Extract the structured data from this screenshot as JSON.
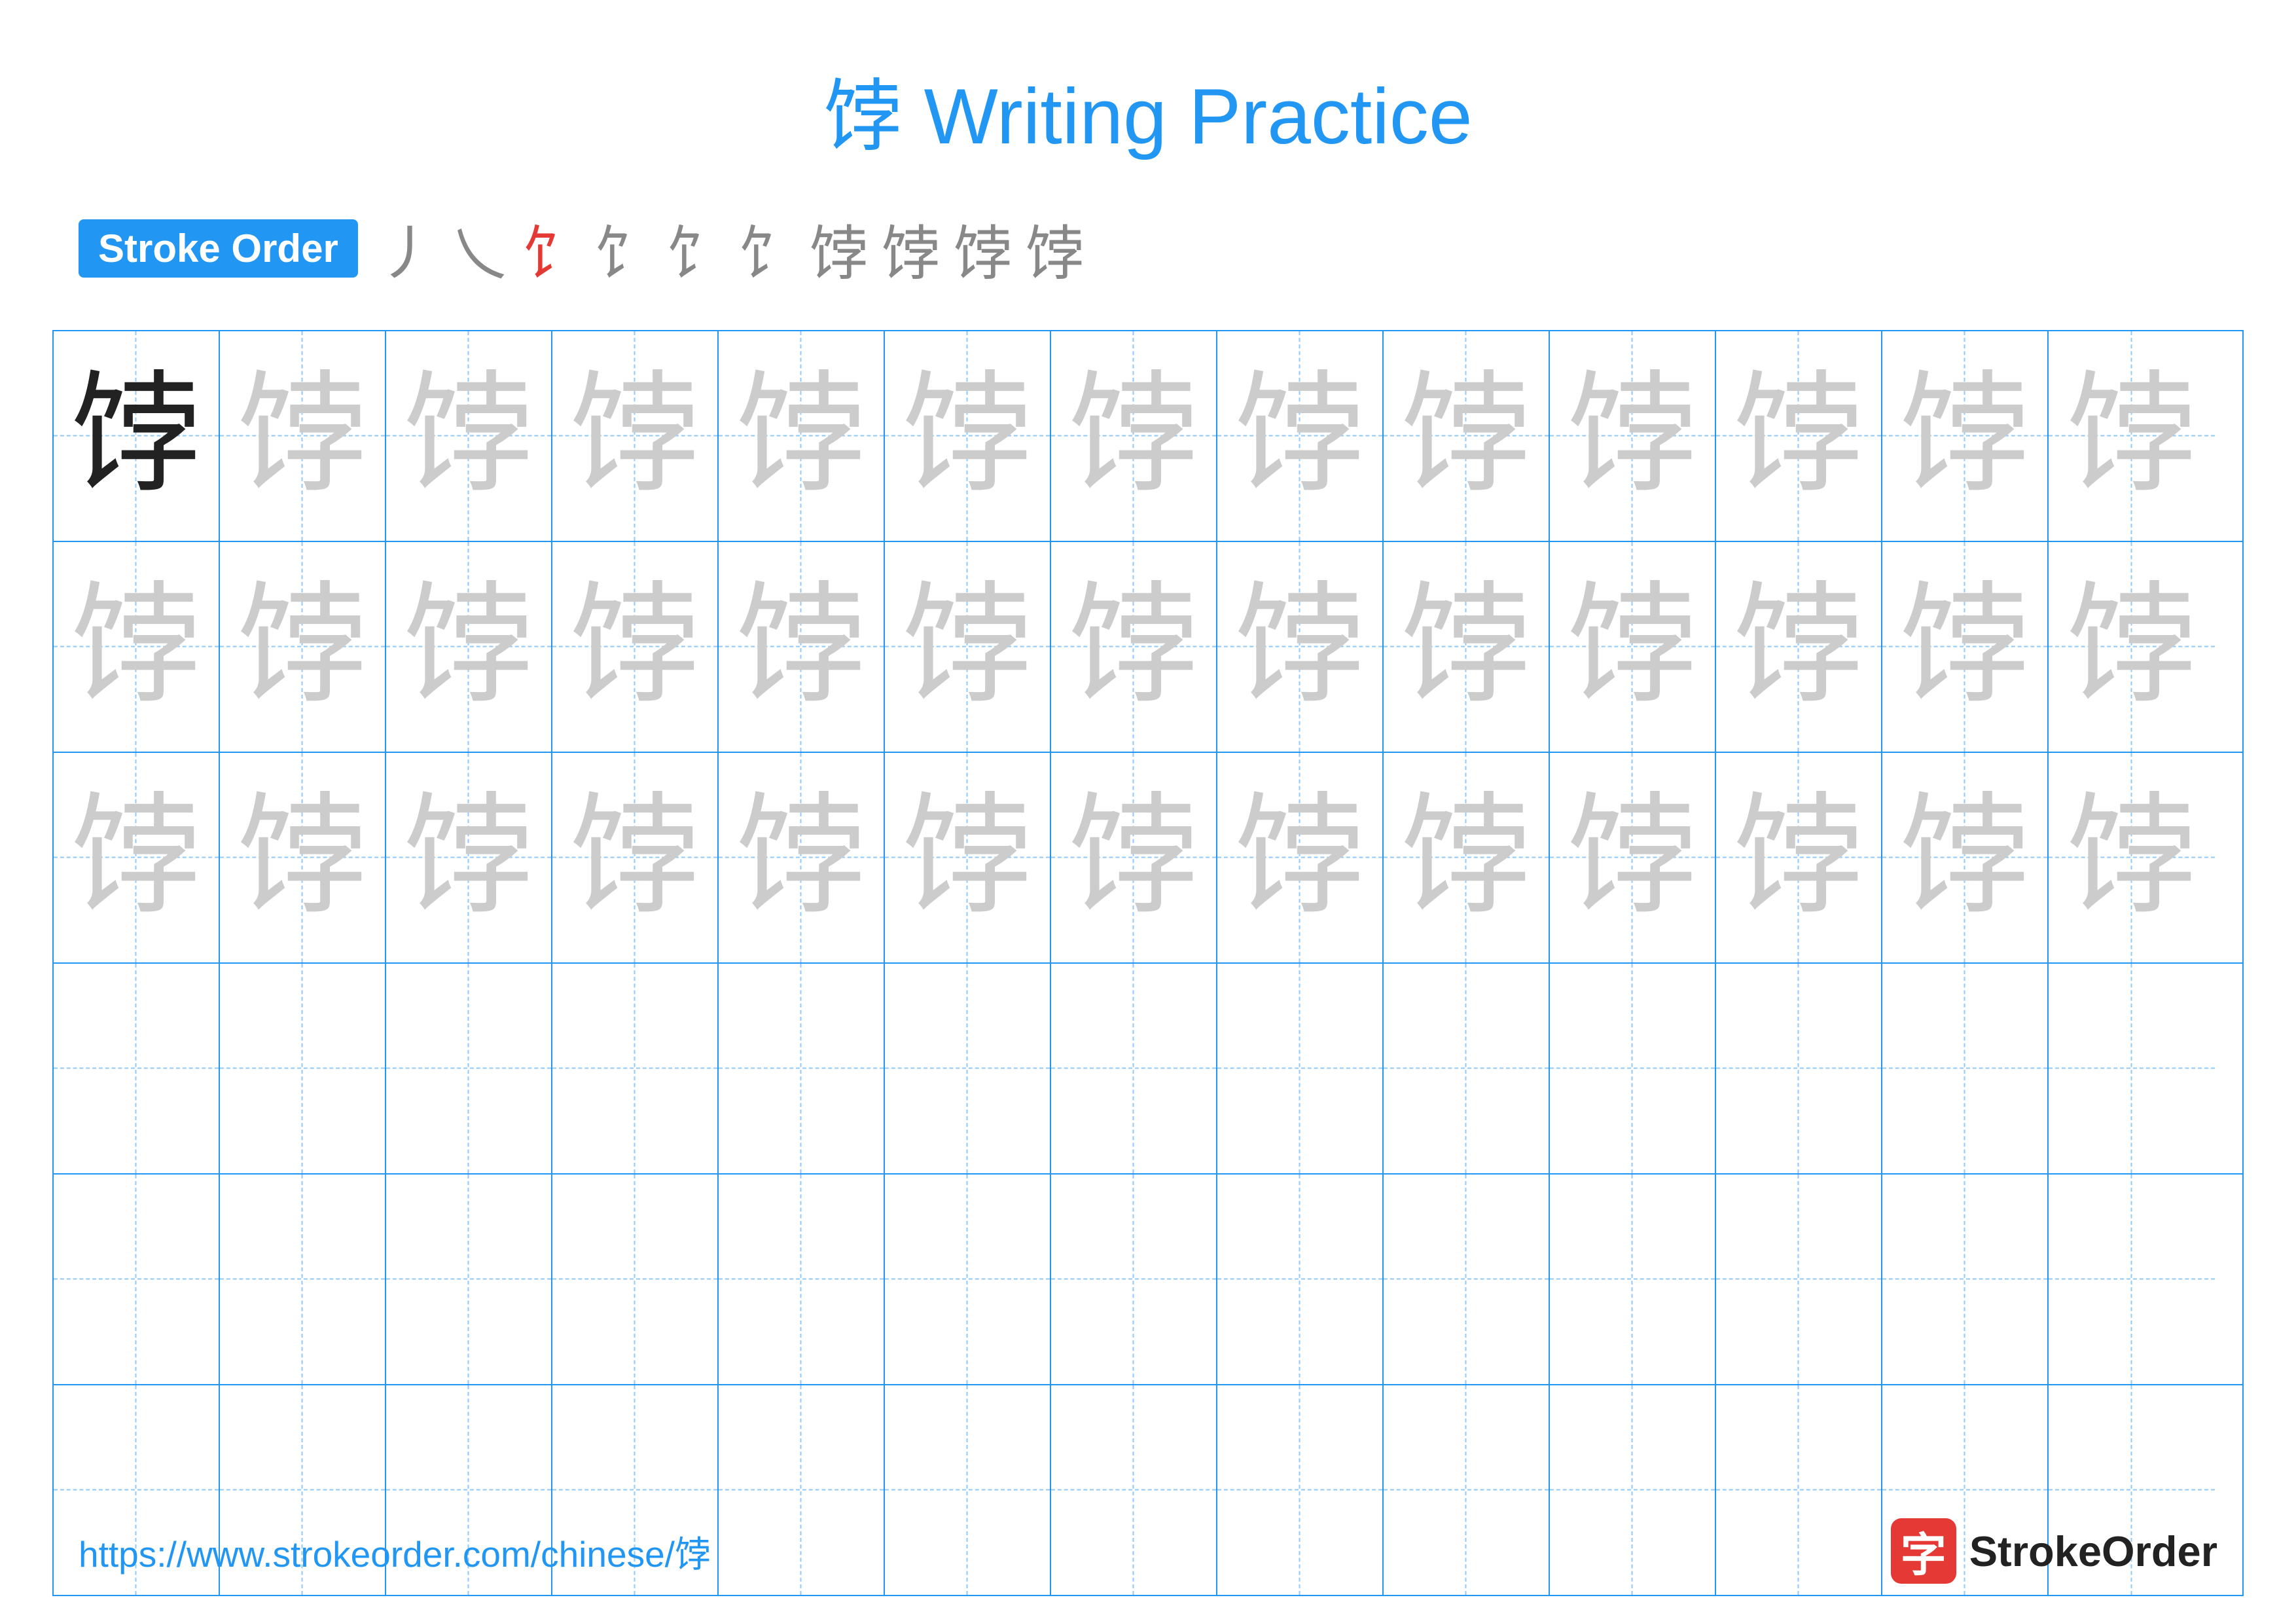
{
  "title": "饽 Writing Practice",
  "strokeOrder": {
    "badge": "Stroke Order",
    "strokes": [
      "丿",
      "乀",
      "饣",
      "饣⁻",
      "饣⁺",
      "饣⁺⁺",
      "饽⁻",
      "饽",
      "饽",
      "饽"
    ]
  },
  "character": "饽",
  "grid": {
    "rows": 6,
    "cols": 13
  },
  "footer": {
    "url": "https://www.strokeorder.com/chinese/饽",
    "logoText": "StrokeOrder",
    "logoChar": "字"
  }
}
